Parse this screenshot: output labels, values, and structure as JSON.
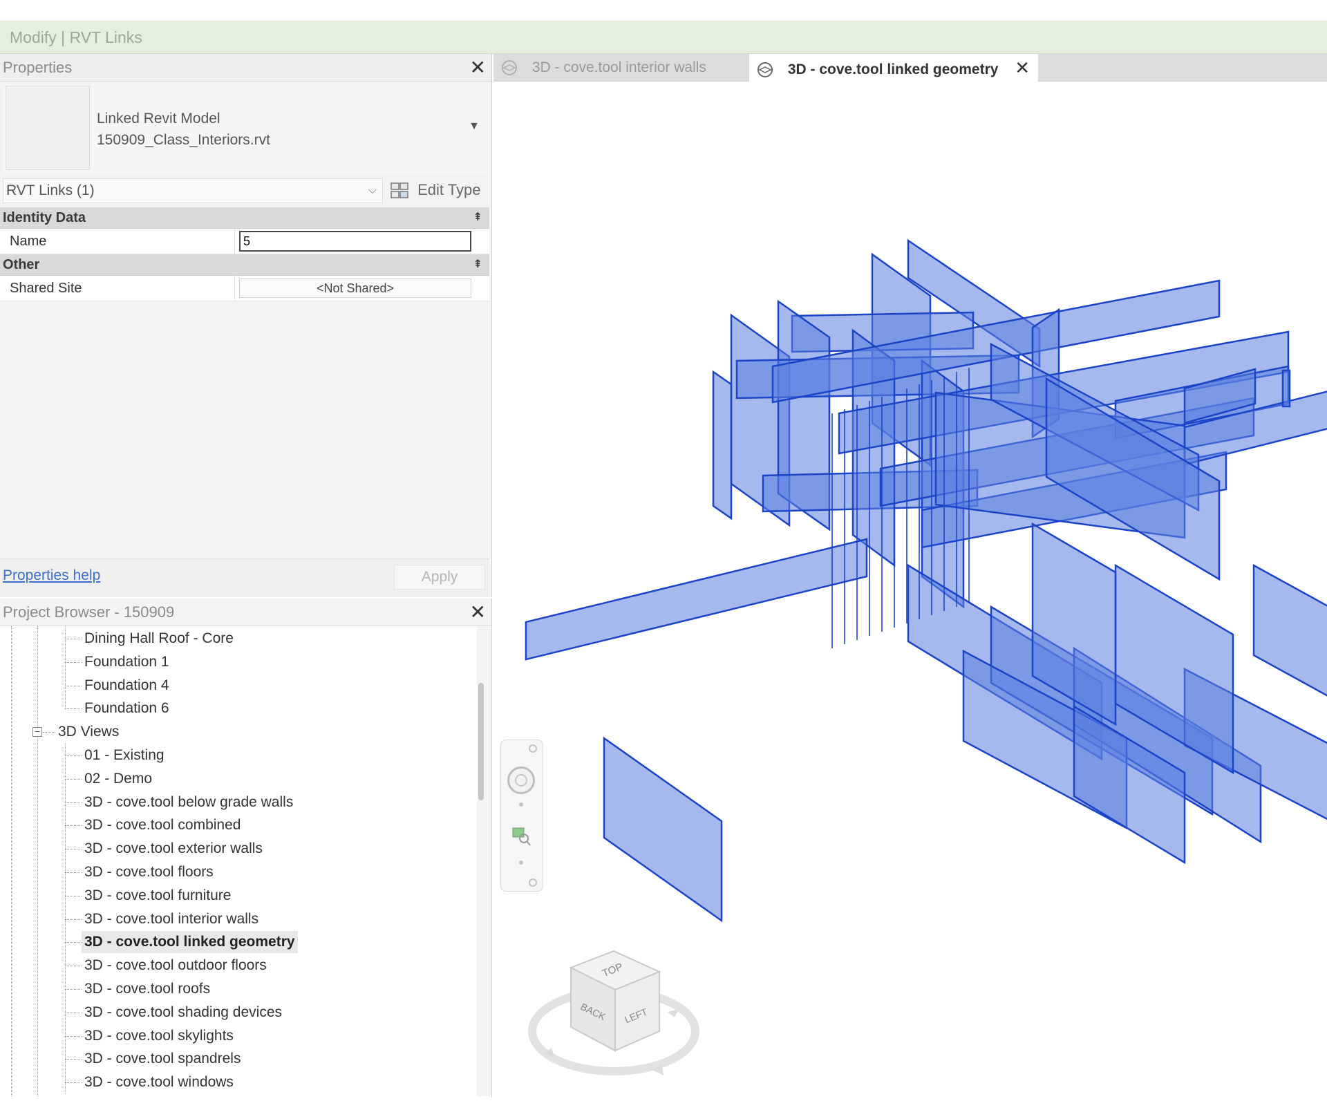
{
  "context_bar": {
    "label": "Modify | RVT Links"
  },
  "properties": {
    "title": "Properties",
    "close_glyph": "✕",
    "type_selector": {
      "line1": "Linked Revit Model",
      "line2": "150909_Class_Interiors.rvt",
      "arrow": "▼"
    },
    "filter": {
      "value": "RVT Links (1)",
      "chevron": "⌵"
    },
    "edit_type_label": "Edit Type",
    "groups": [
      {
        "name": "Identity Data",
        "params": [
          {
            "name": "Name",
            "value": "5",
            "kind": "input"
          }
        ]
      },
      {
        "name": "Other",
        "params": [
          {
            "name": "Shared Site",
            "value": "<Not Shared>",
            "kind": "button"
          }
        ]
      }
    ],
    "collapse_glyph": "⇞",
    "help_link": "Properties help",
    "apply_label": "Apply"
  },
  "project_browser": {
    "title": "Project Browser - 150909",
    "close_glyph": "✕",
    "items": [
      {
        "label": "Dining Hall Roof - Core",
        "level": 2,
        "selected": false
      },
      {
        "label": "Foundation 1",
        "level": 2,
        "selected": false
      },
      {
        "label": "Foundation 4",
        "level": 2,
        "selected": false
      },
      {
        "label": "Foundation 6",
        "level": 2,
        "selected": false
      },
      {
        "label": "3D Views",
        "level": 1,
        "selected": false,
        "toggle": "−"
      },
      {
        "label": "01 - Existing",
        "level": 2,
        "selected": false
      },
      {
        "label": "02 - Demo",
        "level": 2,
        "selected": false
      },
      {
        "label": "3D - cove.tool below grade walls",
        "level": 2,
        "selected": false
      },
      {
        "label": "3D - cove.tool combined",
        "level": 2,
        "selected": false
      },
      {
        "label": "3D - cove.tool exterior walls",
        "level": 2,
        "selected": false
      },
      {
        "label": "3D - cove.tool floors",
        "level": 2,
        "selected": false
      },
      {
        "label": "3D - cove.tool furniture",
        "level": 2,
        "selected": false
      },
      {
        "label": "3D - cove.tool interior walls",
        "level": 2,
        "selected": false
      },
      {
        "label": "3D - cove.tool linked geometry",
        "level": 2,
        "selected": true
      },
      {
        "label": "3D - cove.tool outdoor floors",
        "level": 2,
        "selected": false
      },
      {
        "label": "3D - cove.tool roofs",
        "level": 2,
        "selected": false
      },
      {
        "label": "3D - cove.tool shading devices",
        "level": 2,
        "selected": false
      },
      {
        "label": "3D - cove.tool skylights",
        "level": 2,
        "selected": false
      },
      {
        "label": "3D - cove.tool spandrels",
        "level": 2,
        "selected": false
      },
      {
        "label": "3D - cove.tool windows",
        "level": 2,
        "selected": false
      }
    ],
    "scrollbar": {
      "position": 0.12,
      "visible_fraction": 0.25
    }
  },
  "view_tabs": [
    {
      "label": "3D - cove.tool interior walls",
      "active": false
    },
    {
      "label": "3D - cove.tool linked geometry",
      "active": true,
      "close_glyph": "✕"
    }
  ],
  "viewcube": {
    "labels": [
      "TOP",
      "BACK",
      "LEFT"
    ]
  },
  "colors": {
    "geometry_fill": "#5b7fe0",
    "geometry_edge": "#1c44c8",
    "context_bar_bg": "#e4f0dc",
    "link_blue": "#3a6fcf"
  },
  "icons": {
    "edit_type": "edit-type-icon",
    "view_tab": "3d-view-icon",
    "nav_wheel": "steering-wheel-icon",
    "nav_zoom": "zoom-region-icon",
    "viewcube": "viewcube-icon"
  }
}
